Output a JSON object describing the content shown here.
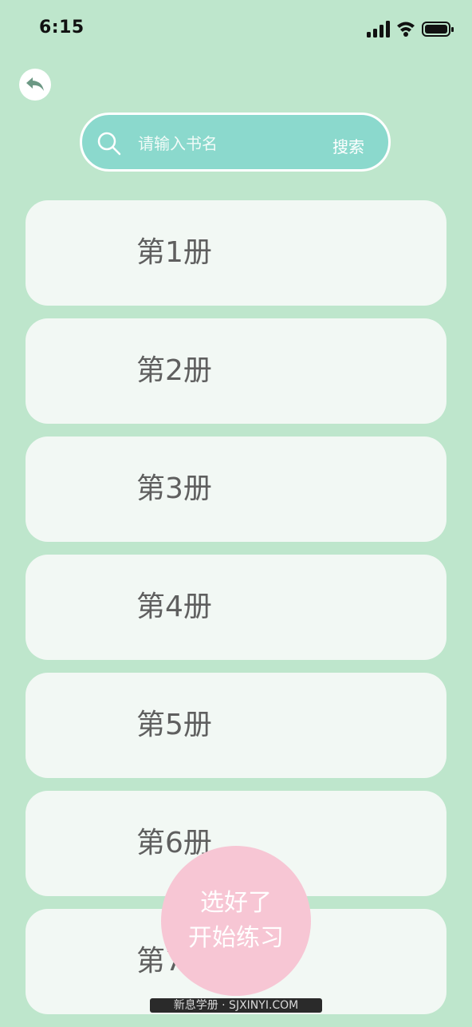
{
  "status_bar": {
    "time": "6:15",
    "icons": [
      "signal-icon",
      "wifi-icon",
      "battery-icon"
    ]
  },
  "back_button": {
    "icon": "back-arrow-icon"
  },
  "search": {
    "placeholder": "请输入书名",
    "value": "",
    "button_label": "搜索",
    "icon": "search-icon"
  },
  "books": [
    {
      "label": "第1册"
    },
    {
      "label": "第2册"
    },
    {
      "label": "第3册"
    },
    {
      "label": "第4册"
    },
    {
      "label": "第5册"
    },
    {
      "label": "第6册"
    },
    {
      "label": "第7册"
    }
  ],
  "start_button": {
    "line1": "选好了",
    "line2": "开始练习"
  },
  "watermark": {
    "text": "新息学册 · SJXINYI.COM"
  },
  "colors": {
    "background": "#bee6cc",
    "search_bar": "#8bd9cd",
    "card": "#f2f8f4",
    "card_text": "#5f5f5f",
    "start_button": "#f7c6d4"
  }
}
